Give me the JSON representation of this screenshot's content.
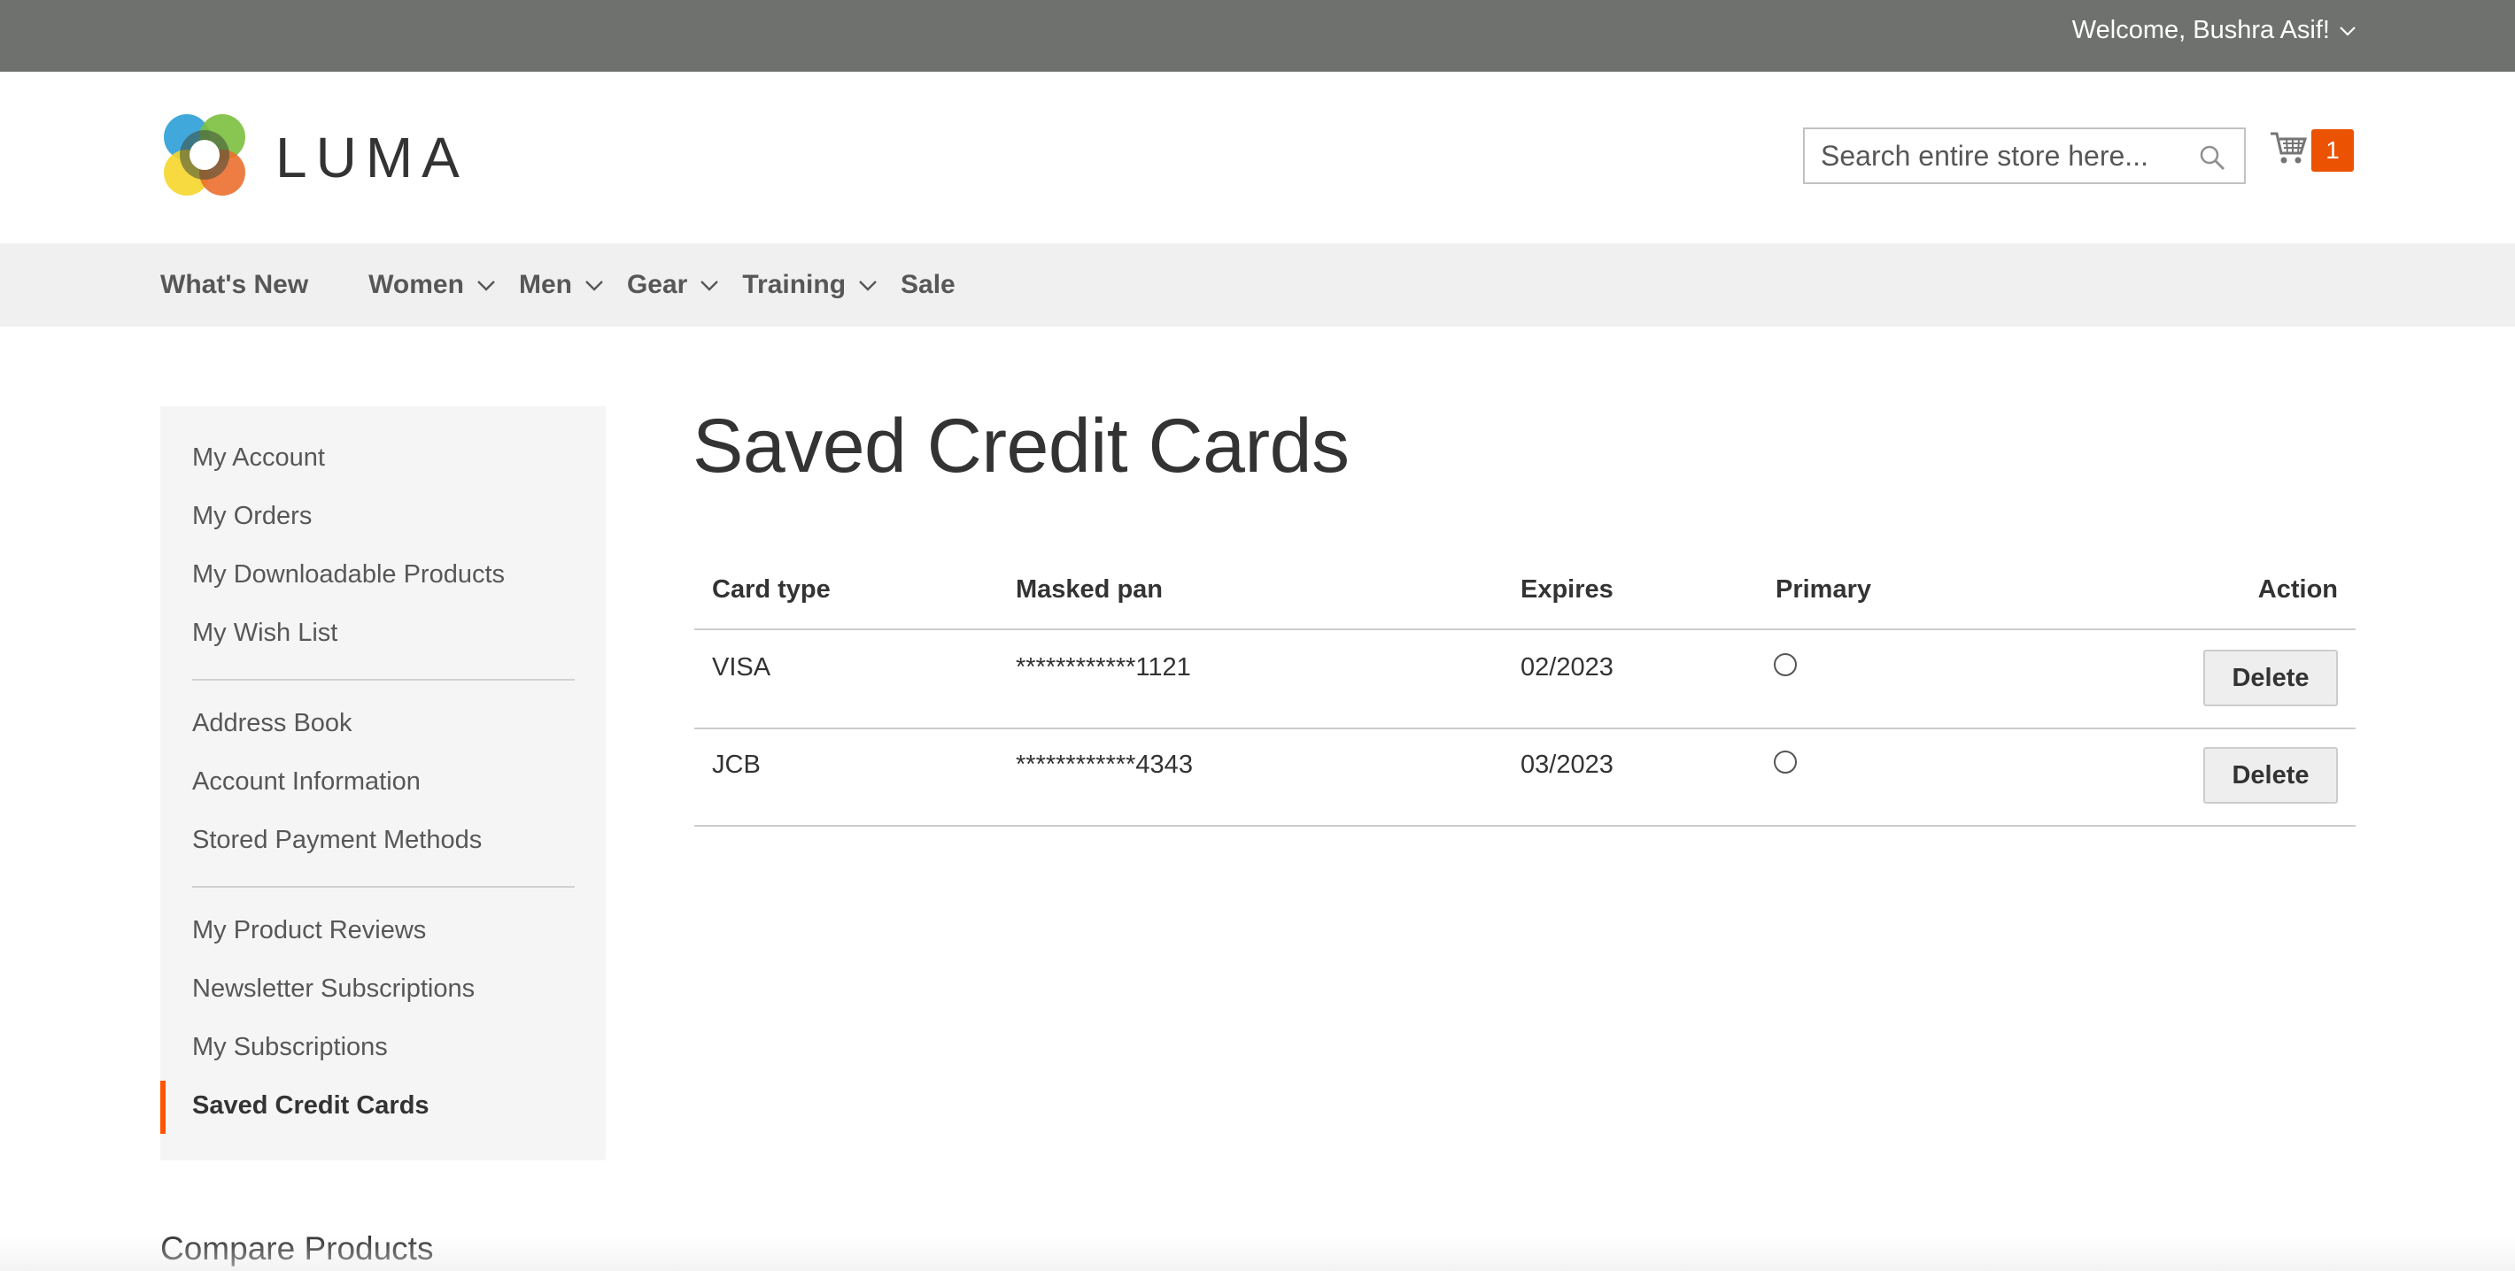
{
  "top_bar": {
    "welcome_text": "Welcome, Bushra Asif!"
  },
  "header": {
    "logo_text": "LUMA",
    "search_placeholder": "Search entire store here...",
    "cart_count": "1"
  },
  "nav": {
    "items": [
      {
        "label": "What's New",
        "has_submenu": false
      },
      {
        "label": "Women",
        "has_submenu": true
      },
      {
        "label": "Men",
        "has_submenu": true
      },
      {
        "label": "Gear",
        "has_submenu": true
      },
      {
        "label": "Training",
        "has_submenu": true
      },
      {
        "label": "Sale",
        "has_submenu": false
      }
    ]
  },
  "sidebar": {
    "items": [
      {
        "label": "My Account"
      },
      {
        "label": "My Orders"
      },
      {
        "label": "My Downloadable Products"
      },
      {
        "label": "My Wish List"
      },
      {
        "label": "Address Book"
      },
      {
        "label": "Account Information"
      },
      {
        "label": "Stored Payment Methods"
      },
      {
        "label": "My Product Reviews"
      },
      {
        "label": "Newsletter Subscriptions"
      },
      {
        "label": "My Subscriptions"
      },
      {
        "label": "Saved Credit Cards",
        "current": true
      }
    ]
  },
  "main": {
    "title": "Saved Credit Cards",
    "table": {
      "headers": {
        "card_type": "Card type",
        "masked_pan": "Masked pan",
        "expires": "Expires",
        "primary": "Primary",
        "action": "Action"
      },
      "rows": [
        {
          "card_type": "VISA",
          "masked_pan": "************1121",
          "expires": "02/2023",
          "primary": false,
          "action": "Delete"
        },
        {
          "card_type": "JCB",
          "masked_pan": "************4343",
          "expires": "03/2023",
          "primary": false,
          "action": "Delete"
        }
      ]
    }
  },
  "compare": {
    "title": "Compare Products"
  },
  "colors": {
    "top_bar": "#6e716e",
    "accent": "#eb5202",
    "active_marker": "#ff5501",
    "nav_bg": "#f0f0f0",
    "sidebar_bg": "#f5f5f5"
  },
  "icons": [
    "chevron-down-icon",
    "search-icon",
    "cart-icon",
    "luma-logo-icon"
  ]
}
